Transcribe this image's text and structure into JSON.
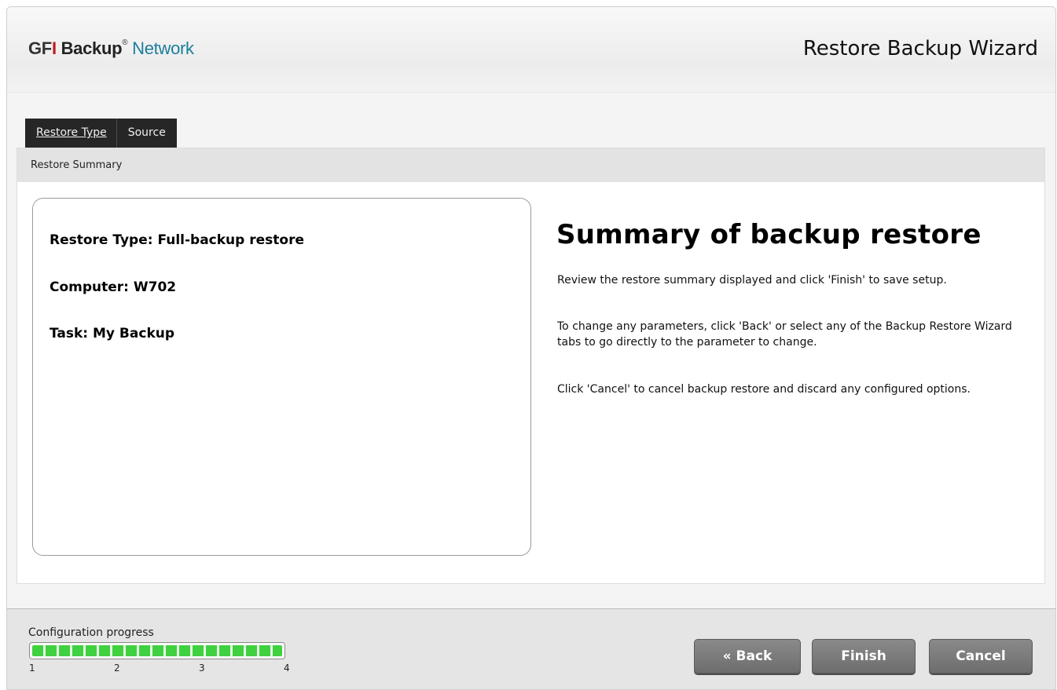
{
  "header": {
    "logo": {
      "gfi_prefix": "GF",
      "gfi_i": "I",
      "backup": "Backup",
      "tm": "®",
      "network": "Network"
    },
    "wizard_title": "Restore Backup Wizard"
  },
  "tabs": [
    {
      "label": "Restore Type"
    },
    {
      "label": "Source"
    }
  ],
  "breadcrumb": "Restore Summary",
  "summary": {
    "restore_type": "Restore Type: Full-backup restore",
    "computer": "Computer: W702",
    "task": "Task: My Backup"
  },
  "help": {
    "title": "Summary of backup restore",
    "paragraphs": [
      "Review the restore summary displayed and click 'Finish' to save setup.",
      "To change any parameters, click 'Back' or select any of the Backup Restore Wizard tabs to go directly to the parameter to change.",
      "Click 'Cancel' to cancel backup restore and discard any configured options."
    ]
  },
  "footer": {
    "progress_label": "Configuration progress",
    "progress_value": 1.0,
    "progress_color": "#3fd13f",
    "steps": [
      "1",
      "2",
      "3",
      "4"
    ],
    "buttons": {
      "back": "« Back",
      "finish": "Finish",
      "cancel": "Cancel"
    }
  }
}
